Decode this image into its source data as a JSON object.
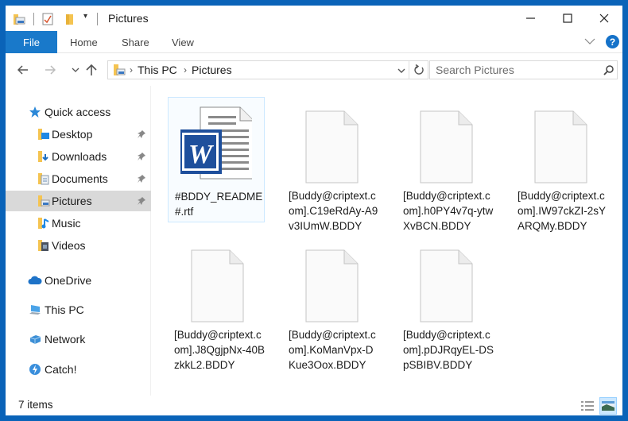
{
  "window": {
    "title": "Pictures",
    "minimize_icon": "minimize-icon",
    "maximize_icon": "maximize-icon",
    "close_icon": "close-icon"
  },
  "ribbon": {
    "tabs": [
      {
        "label": "File",
        "active": true
      },
      {
        "label": "Home"
      },
      {
        "label": "Share"
      },
      {
        "label": "View"
      }
    ],
    "help_label": "?"
  },
  "navigation": {
    "breadcrumb": [
      "This PC",
      "Pictures"
    ],
    "search_placeholder": "Search Pictures"
  },
  "sidebar": {
    "items": [
      {
        "label": "Quick access",
        "icon": "star-icon"
      },
      {
        "label": "Desktop",
        "icon": "desktop-folder-icon",
        "pinned": true
      },
      {
        "label": "Downloads",
        "icon": "downloads-folder-icon",
        "pinned": true
      },
      {
        "label": "Documents",
        "icon": "documents-folder-icon",
        "pinned": true
      },
      {
        "label": "Pictures",
        "icon": "pictures-folder-icon",
        "pinned": true,
        "selected": true
      },
      {
        "label": "Music",
        "icon": "music-folder-icon"
      },
      {
        "label": "Videos",
        "icon": "videos-folder-icon"
      },
      {
        "label": "OneDrive",
        "icon": "onedrive-icon"
      },
      {
        "label": "This PC",
        "icon": "this-pc-icon"
      },
      {
        "label": "Network",
        "icon": "network-icon"
      },
      {
        "label": "Catch!",
        "icon": "catch-icon"
      }
    ]
  },
  "files": [
    {
      "name": "#BDDY_README#.rtf",
      "type": "word-document",
      "selected": true
    },
    {
      "name": "[Buddy@criptext.com].C19eRdAy-A9v3IUmW.BDDY",
      "type": "blank"
    },
    {
      "name": "[Buddy@criptext.com].h0PY4v7q-ytwXvBCN.BDDY",
      "type": "blank"
    },
    {
      "name": "[Buddy@criptext.com].IW97ckZI-2sYARQMy.BDDY",
      "type": "blank"
    },
    {
      "name": "[Buddy@criptext.com].J8QgjpNx-40BzkkL2.BDDY",
      "type": "blank"
    },
    {
      "name": "[Buddy@criptext.com].KoManVpx-DKue3Oox.BDDY",
      "type": "blank"
    },
    {
      "name": "[Buddy@criptext.com].pDJRqyEL-DSpSBIBV.BDDY",
      "type": "blank"
    }
  ],
  "status": {
    "item_count": "7 items"
  },
  "colors": {
    "accent": "#1979ca",
    "frame": "#0a63b8",
    "selection": "#d9d9d9"
  }
}
